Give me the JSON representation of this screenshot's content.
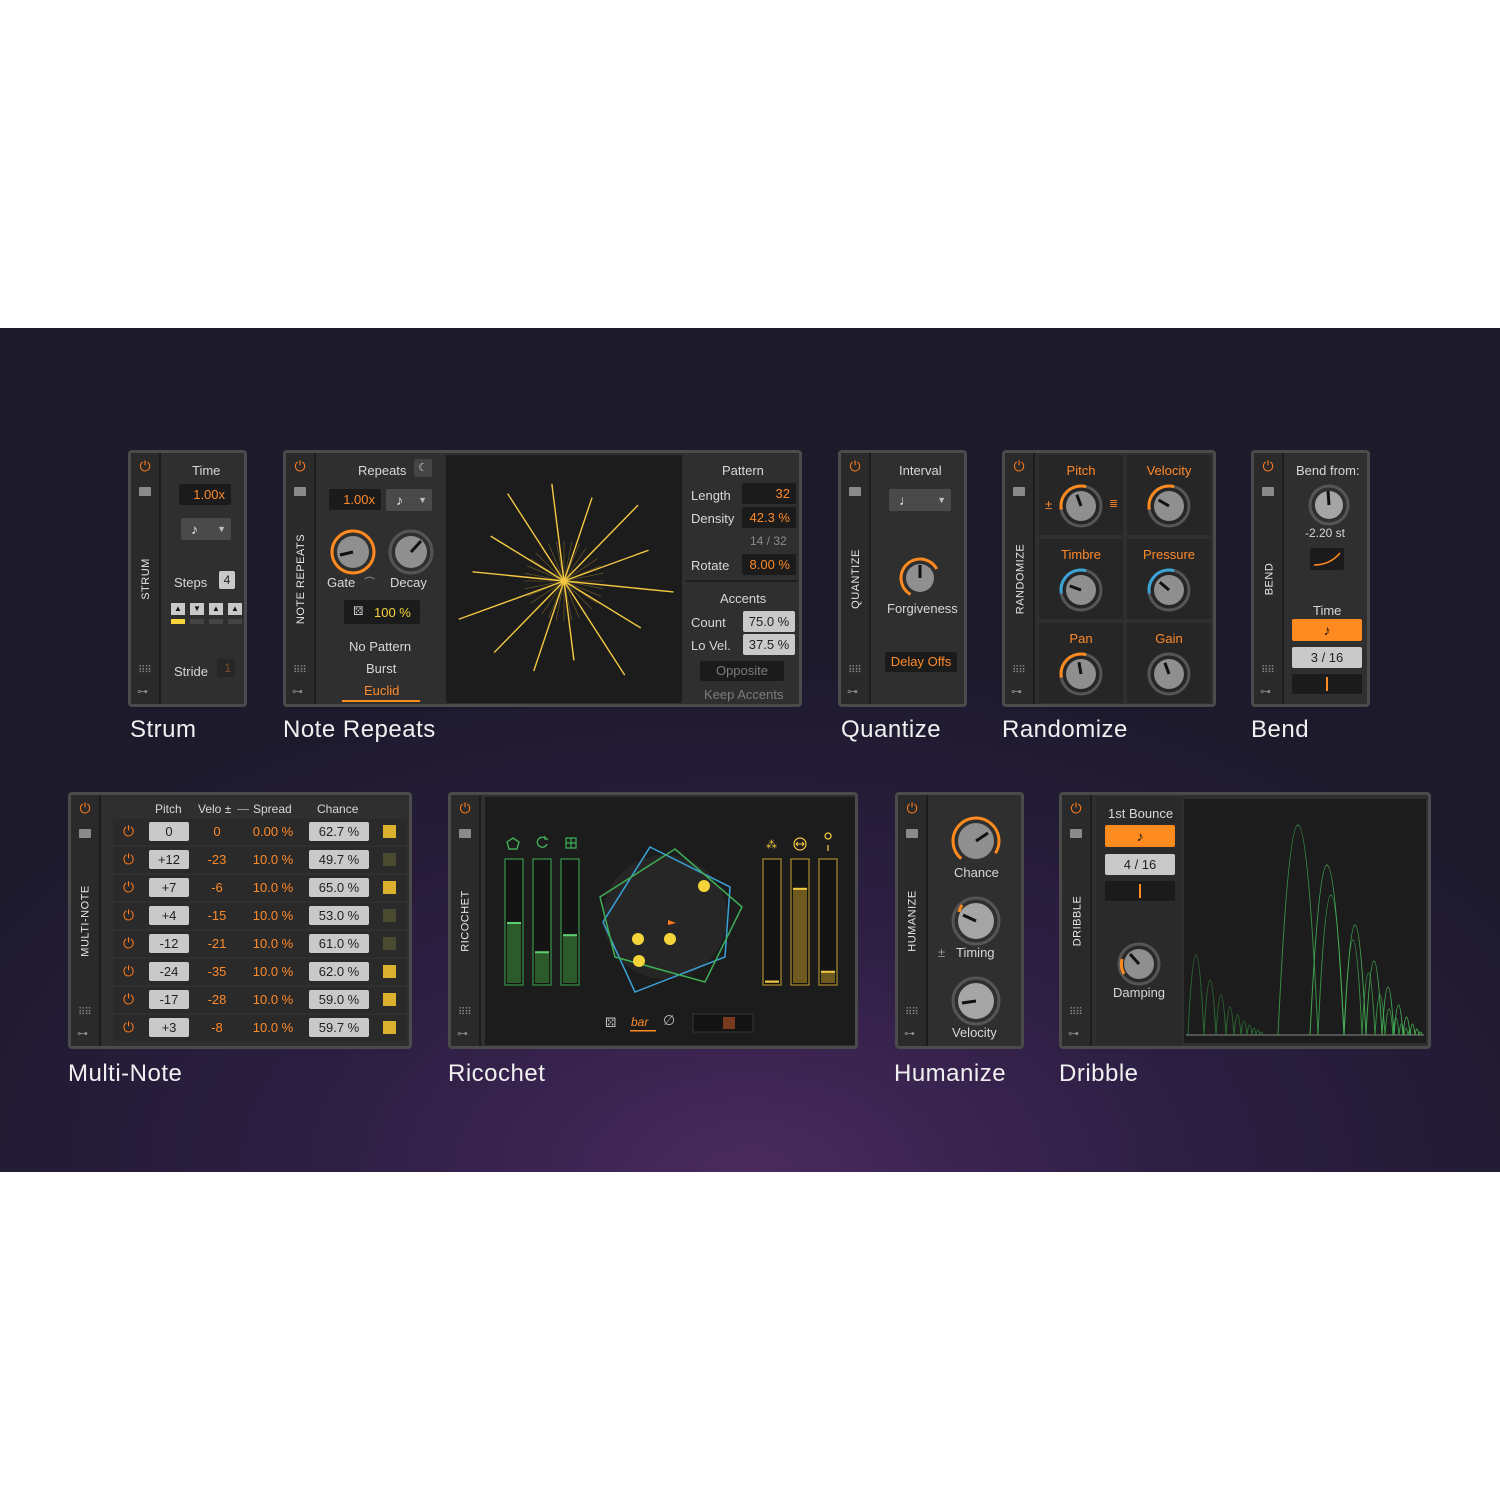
{
  "devices": {
    "strum": {
      "label": "STRUM",
      "title": "Strum",
      "time_label": "Time",
      "time_value": "1.00x",
      "note_icon": "♪",
      "steps_label": "Steps",
      "steps_value": "4",
      "stride_label": "Stride",
      "stride_value": "1"
    },
    "note_repeats": {
      "label": "NOTE REPEATS",
      "title": "Note Repeats",
      "repeats_label": "Repeats",
      "repeats_value": "1.00x",
      "note_icon": "♪",
      "gate_label": "Gate",
      "decay_label": "Decay",
      "chance_value": "100 %",
      "modes": [
        "No Pattern",
        "Burst",
        "Euclid"
      ],
      "pattern_label": "Pattern",
      "length_label": "Length",
      "length_value": "32",
      "density_label": "Density",
      "density_value": "42.3 %",
      "ratio": "14 / 32",
      "rotate_label": "Rotate",
      "rotate_value": "8.00 %",
      "accents_label": "Accents",
      "count_label": "Count",
      "count_value": "75.0 %",
      "lovel_label": "Lo Vel.",
      "lovel_value": "37.5 %",
      "opposite_label": "Opposite",
      "keep_label": "Keep Accents"
    },
    "quantize": {
      "label": "QUANTIZE",
      "title": "Quantize",
      "interval_label": "Interval",
      "note_icon": "♩",
      "forgiveness_label": "Forgiveness",
      "delay_label": "Delay Offs"
    },
    "randomize": {
      "label": "RANDOMIZE",
      "title": "Randomize",
      "cells": [
        "Pitch",
        "Velocity",
        "Timbre",
        "Pressure",
        "Pan",
        "Gain"
      ]
    },
    "bend": {
      "label": "BEND",
      "title": "Bend",
      "bend_from_label": "Bend from:",
      "bend_value": "-2.20 st",
      "time_label": "Time",
      "note_icon": "♪",
      "fraction": "3 / 16"
    },
    "multi_note": {
      "label": "MULTI-NOTE",
      "title": "Multi-Note",
      "headers": {
        "pitch": "Pitch",
        "velo": "Velo ±",
        "spread": "Spread",
        "chance": "Chance"
      },
      "rows": [
        {
          "pitch": "0",
          "velo": "0",
          "spread": "0.00 %",
          "chance": "62.7 %",
          "on": true
        },
        {
          "pitch": "+12",
          "velo": "-23",
          "spread": "10.0 %",
          "chance": "49.7 %",
          "on": false
        },
        {
          "pitch": "+7",
          "velo": "-6",
          "spread": "10.0 %",
          "chance": "65.0 %",
          "on": true
        },
        {
          "pitch": "+4",
          "velo": "-15",
          "spread": "10.0 %",
          "chance": "53.0 %",
          "on": false
        },
        {
          "pitch": "-12",
          "velo": "-21",
          "spread": "10.0 %",
          "chance": "61.0 %",
          "on": false
        },
        {
          "pitch": "-24",
          "velo": "-35",
          "spread": "10.0 %",
          "chance": "62.0 %",
          "on": true
        },
        {
          "pitch": "-17",
          "velo": "-28",
          "spread": "10.0 %",
          "chance": "59.0 %",
          "on": true
        },
        {
          "pitch": "+3",
          "velo": "-8",
          "spread": "10.0 %",
          "chance": "59.7 %",
          "on": true
        }
      ]
    },
    "ricochet": {
      "label": "RICOCHET",
      "title": "Ricochet",
      "bar_label": "bar",
      "empty_set": "∅",
      "left_levels": [
        0.5,
        0.26,
        0.4
      ],
      "right_levels": [
        0.02,
        0.78,
        0.1
      ]
    },
    "humanize": {
      "label": "HUMANIZE",
      "title": "Humanize",
      "chance_label": "Chance",
      "timing_label": "Timing",
      "velocity_label": "Velocity",
      "pm": "±"
    },
    "dribble": {
      "label": "DRIBBLE",
      "title": "Dribble",
      "bounce_label": "1st Bounce",
      "note_icon": "♪",
      "fraction": "4 / 16",
      "damping_label": "Damping"
    }
  },
  "colors": {
    "accent": "#ff8a1f",
    "yellow": "#f5c842",
    "green": "#3fae55",
    "blue": "#3aa3d8",
    "panel": "#2f2f2f"
  }
}
